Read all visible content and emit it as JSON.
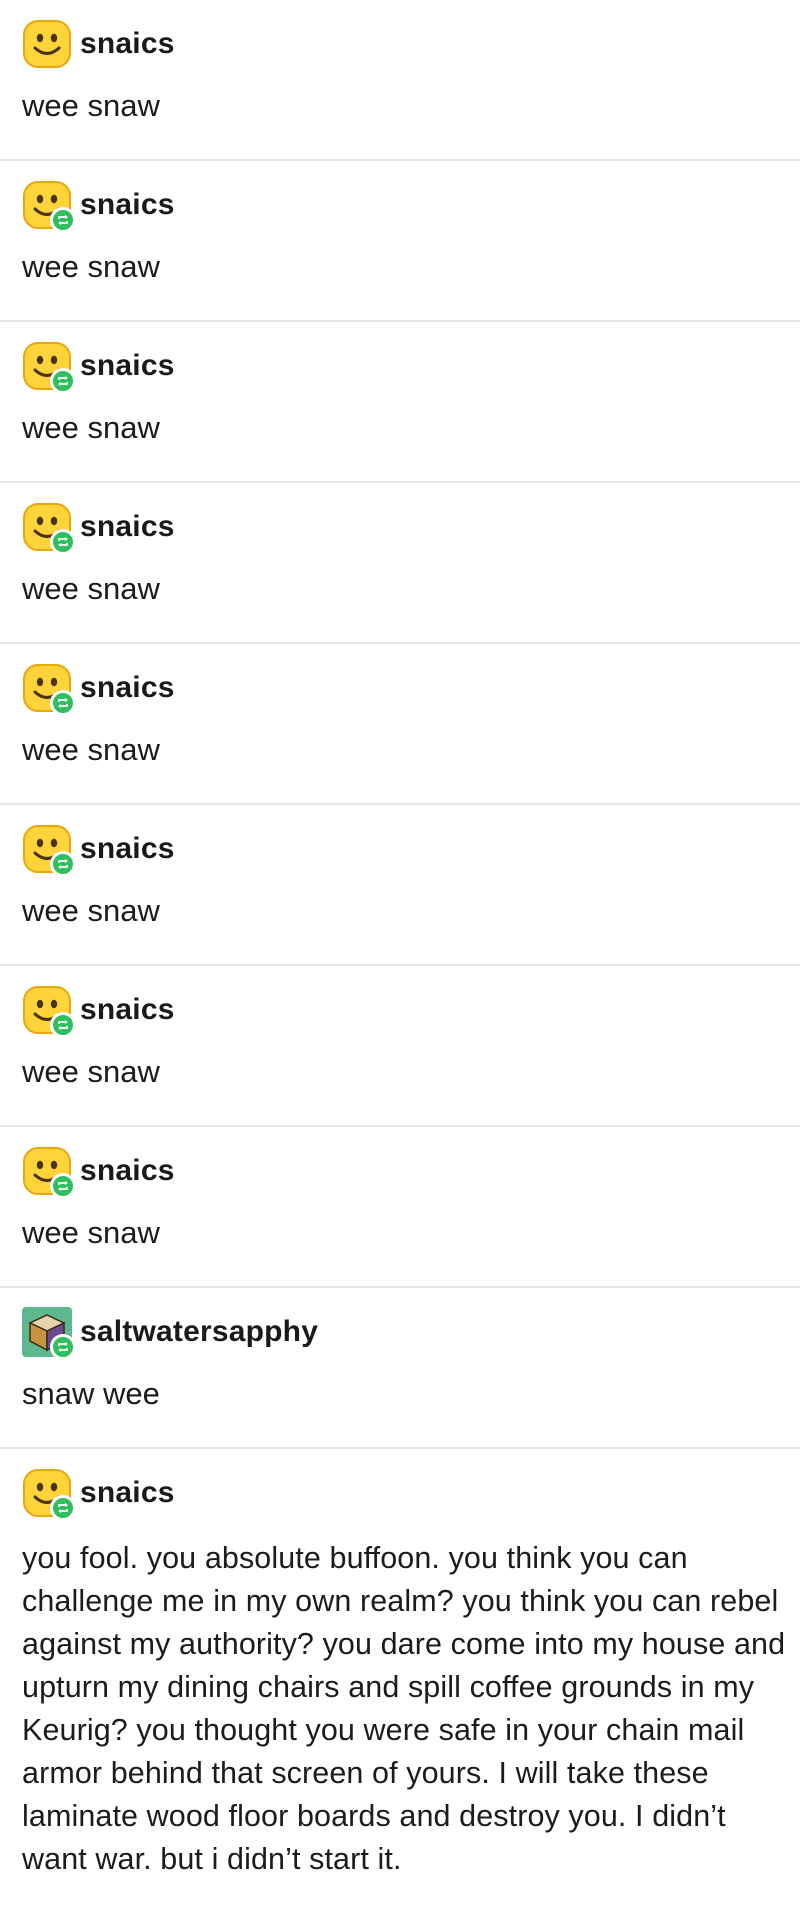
{
  "colors": {
    "divider": "#e6e6e6",
    "reblog_badge": "#2fbf5f",
    "emoji_yellow": "#ffd43b",
    "text": "#1c1c1c"
  },
  "icons": {
    "avatar_snaics": "smiley-emoji-icon",
    "avatar_saltwatersapphy": "cube-box-icon",
    "reblog_badge": "reblog-arrows-icon"
  },
  "posts": [
    {
      "username": "snaics",
      "avatar": "smiley",
      "reblog": false,
      "body": "wee snaw"
    },
    {
      "username": "snaics",
      "avatar": "smiley",
      "reblog": true,
      "body": "wee snaw"
    },
    {
      "username": "snaics",
      "avatar": "smiley",
      "reblog": true,
      "body": "wee snaw"
    },
    {
      "username": "snaics",
      "avatar": "smiley",
      "reblog": true,
      "body": "wee snaw"
    },
    {
      "username": "snaics",
      "avatar": "smiley",
      "reblog": true,
      "body": "wee snaw"
    },
    {
      "username": "snaics",
      "avatar": "smiley",
      "reblog": true,
      "body": "wee snaw"
    },
    {
      "username": "snaics",
      "avatar": "smiley",
      "reblog": true,
      "body": "wee snaw"
    },
    {
      "username": "snaics",
      "avatar": "smiley",
      "reblog": true,
      "body": "wee snaw"
    },
    {
      "username": "saltwatersapphy",
      "avatar": "cube",
      "reblog": true,
      "body": "snaw wee"
    },
    {
      "username": "snaics",
      "avatar": "smiley",
      "reblog": true,
      "body": "you fool. you absolute buffoon. you think you can challenge me in my own realm? you think you can rebel against my authority? you dare come into my house and upturn my dining chairs and spill coffee grounds in my Keurig? you thought you were safe in your chain mail armor behind that screen of yours. I will take these laminate wood floor boards and destroy you. I didn’t want war. but i didn’t start it."
    }
  ]
}
